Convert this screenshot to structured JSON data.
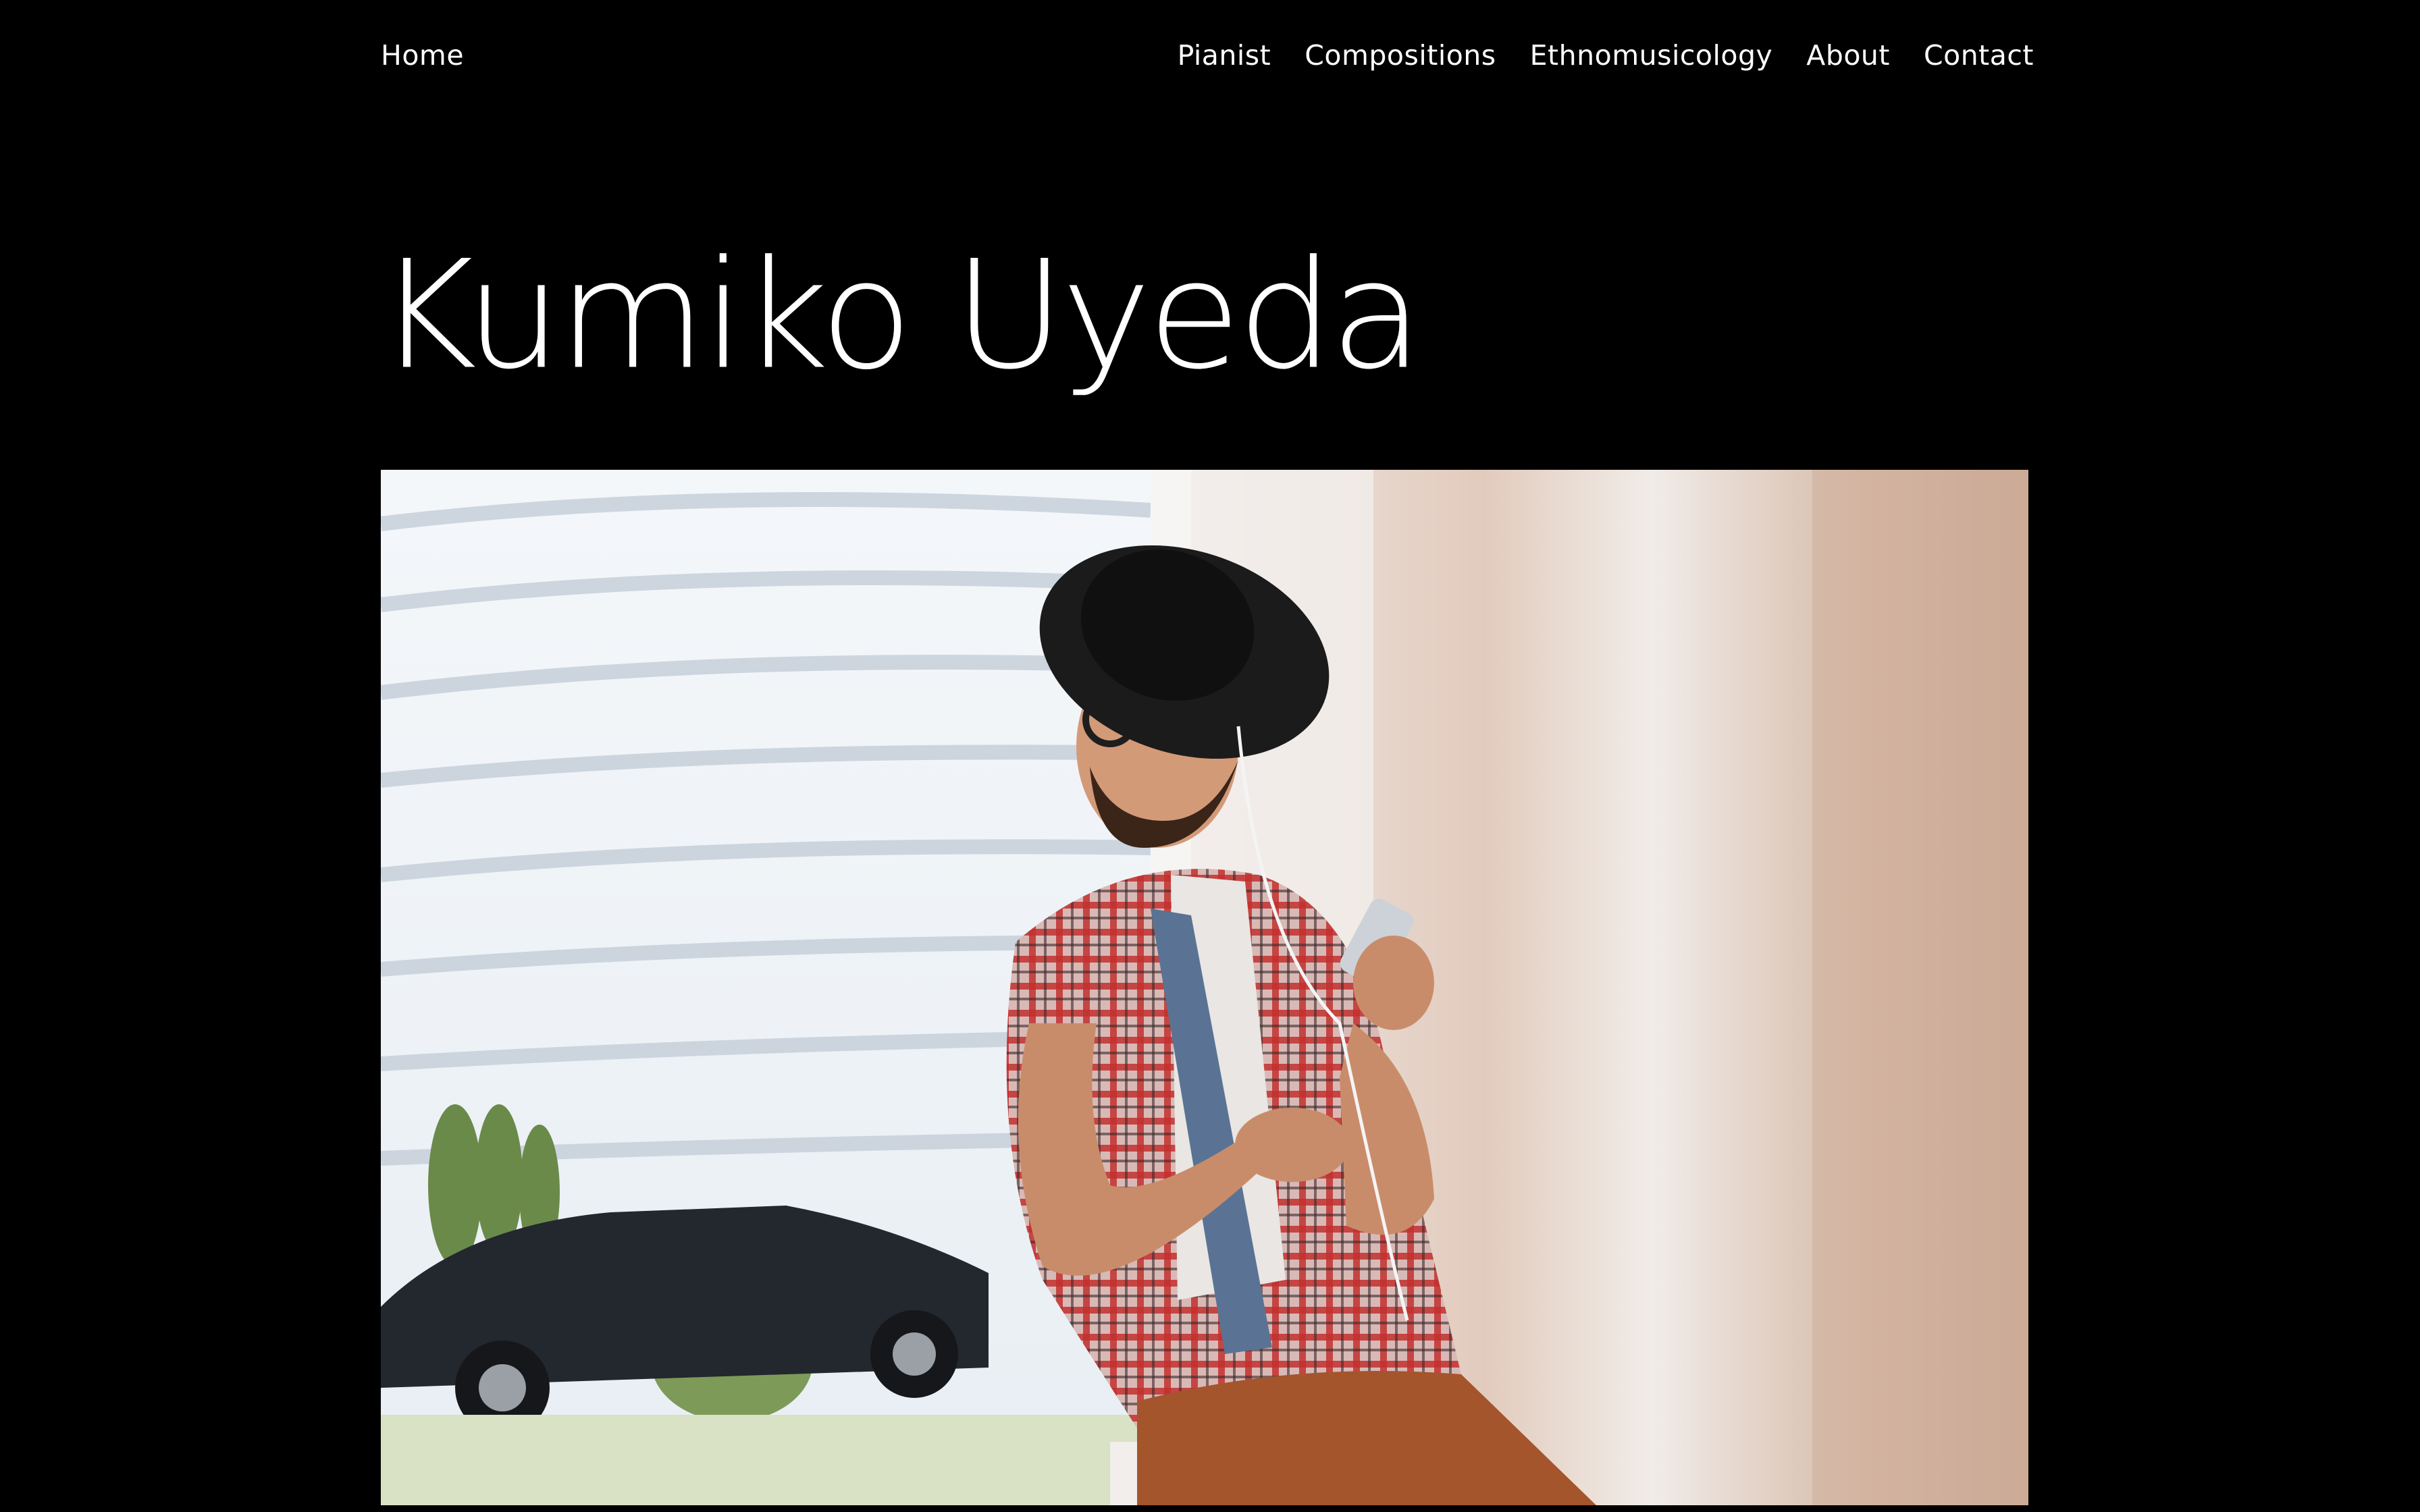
{
  "header": {
    "home_label": "Home",
    "nav": [
      {
        "label": "Pianist"
      },
      {
        "label": "Compositions"
      },
      {
        "label": "Ethnomusicology"
      },
      {
        "label": "About"
      },
      {
        "label": "Contact"
      }
    ]
  },
  "site_title": "Kumiko Uyeda",
  "colors": {
    "background": "#000000",
    "text": "#ffffff"
  },
  "hero_image": {
    "subject": "man-with-hat-and-glasses-holding-phone-by-window"
  }
}
